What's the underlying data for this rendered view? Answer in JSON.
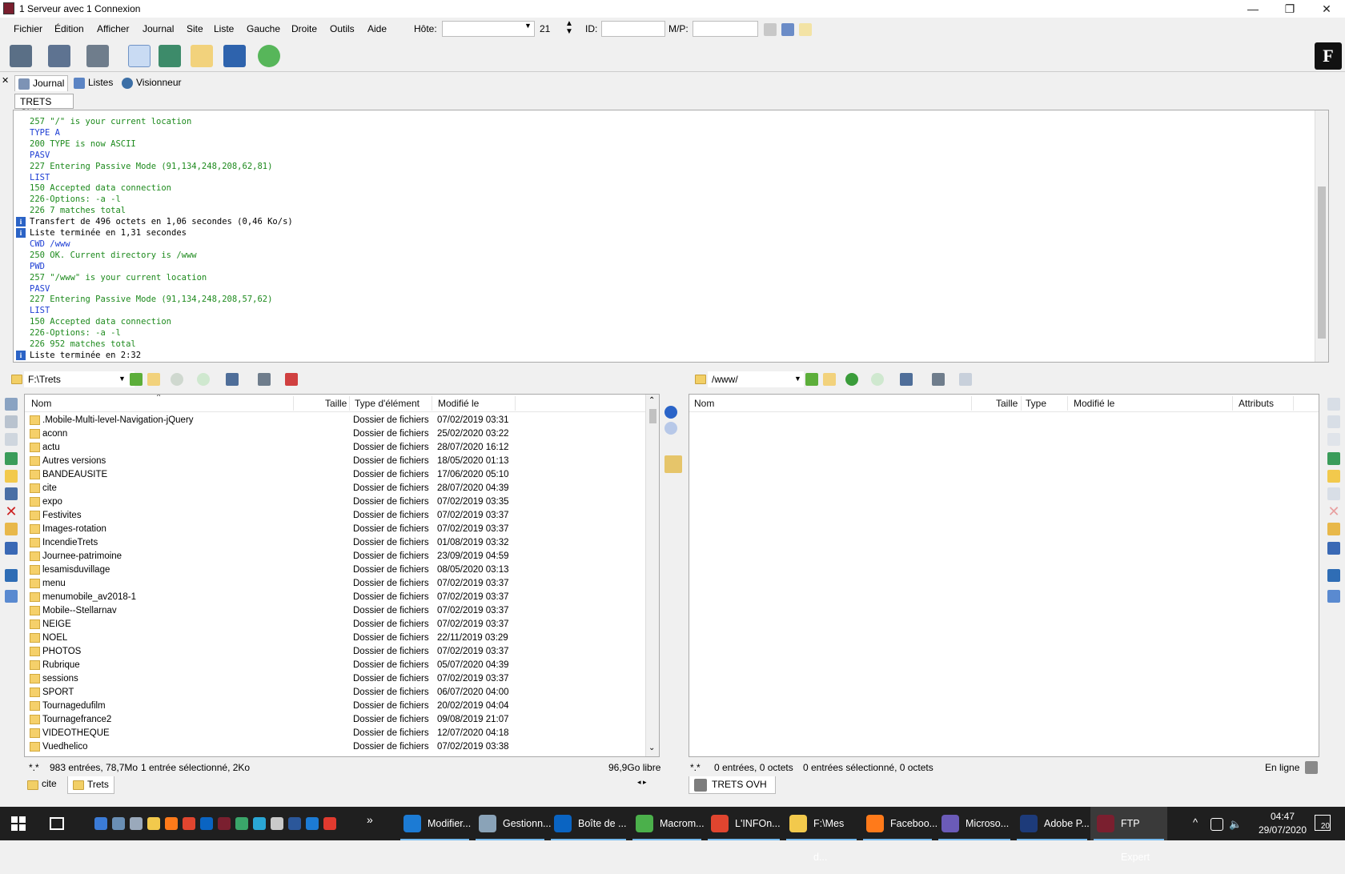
{
  "window": {
    "title": "1 Serveur avec 1 Connexion",
    "minimize": "—",
    "restore": "❐",
    "close": "✕"
  },
  "menu": [
    "Fichier",
    "Édition",
    "Afficher",
    "Journal",
    "Site",
    "Liste",
    "Gauche",
    "Droite",
    "Outils",
    "Aide"
  ],
  "connbar": {
    "host_label": "Hôte:",
    "host_value": "",
    "port_value": "21",
    "id_label": "ID:",
    "id_value": "",
    "pw_label": "M/P:",
    "pw_value": ""
  },
  "tabs": [
    {
      "label": "Journal",
      "icon": "journal-icon"
    },
    {
      "label": "Listes",
      "icon": "lists-icon"
    },
    {
      "label": "Visionneur",
      "icon": "viewer-icon"
    }
  ],
  "connection_tab": "TRETS OVH",
  "log": [
    {
      "text": "257 \"/\" is your current location",
      "kind": "resp"
    },
    {
      "text": "TYPE A",
      "kind": "cmd"
    },
    {
      "text": "200 TYPE is now ASCII",
      "kind": "resp"
    },
    {
      "text": "PASV",
      "kind": "cmd"
    },
    {
      "text": "227 Entering Passive Mode (91,134,248,208,62,81)",
      "kind": "resp"
    },
    {
      "text": "LIST",
      "kind": "cmd"
    },
    {
      "text": "150 Accepted data connection",
      "kind": "resp"
    },
    {
      "text": "226-Options: -a -l",
      "kind": "resp"
    },
    {
      "text": "226 7 matches total",
      "kind": "resp"
    },
    {
      "text": "Transfert de 496 octets en 1,06 secondes (0,46 Ko/s)",
      "kind": "info"
    },
    {
      "text": "Liste terminée en 1,31 secondes",
      "kind": "info"
    },
    {
      "text": "CWD /www",
      "kind": "cmd"
    },
    {
      "text": "250 OK. Current directory is /www",
      "kind": "resp"
    },
    {
      "text": "PWD",
      "kind": "cmd"
    },
    {
      "text": "257 \"/www\" is your current location",
      "kind": "resp"
    },
    {
      "text": "PASV",
      "kind": "cmd"
    },
    {
      "text": "227 Entering Passive Mode (91,134,248,208,57,62)",
      "kind": "resp"
    },
    {
      "text": "LIST",
      "kind": "cmd"
    },
    {
      "text": "150 Accepted data connection",
      "kind": "resp"
    },
    {
      "text": "226-Options: -a -l",
      "kind": "resp"
    },
    {
      "text": "226 952 matches total",
      "kind": "resp"
    },
    {
      "text": "Liste terminée en 2:32",
      "kind": "info"
    }
  ],
  "left": {
    "path": "F:\\Trets",
    "columns": [
      "Nom",
      "Taille",
      "Type d'élément",
      "Modifié le"
    ],
    "rows": [
      [
        ".Mobile-Multi-level-Navigation-jQuery",
        "Dossier de fichiers",
        "07/02/2019 03:31"
      ],
      [
        "aconn",
        "Dossier de fichiers",
        "25/02/2020 03:22"
      ],
      [
        "actu",
        "Dossier de fichiers",
        "28/07/2020 16:12"
      ],
      [
        "Autres versions",
        "Dossier de fichiers",
        "18/05/2020 01:13"
      ],
      [
        "BANDEAUSITE",
        "Dossier de fichiers",
        "17/06/2020 05:10"
      ],
      [
        "cite",
        "Dossier de fichiers",
        "28/07/2020 04:39"
      ],
      [
        "expo",
        "Dossier de fichiers",
        "07/02/2019 03:35"
      ],
      [
        "Festivites",
        "Dossier de fichiers",
        "07/02/2019 03:37"
      ],
      [
        "Images-rotation",
        "Dossier de fichiers",
        "07/02/2019 03:37"
      ],
      [
        "IncendieTrets",
        "Dossier de fichiers",
        "01/08/2019 03:32"
      ],
      [
        "Journee-patrimoine",
        "Dossier de fichiers",
        "23/09/2019 04:59"
      ],
      [
        "lesamisduvillage",
        "Dossier de fichiers",
        "08/05/2020 03:13"
      ],
      [
        "menu",
        "Dossier de fichiers",
        "07/02/2019 03:37"
      ],
      [
        "menumobile_av2018-1",
        "Dossier de fichiers",
        "07/02/2019 03:37"
      ],
      [
        "Mobile--Stellarnav",
        "Dossier de fichiers",
        "07/02/2019 03:37"
      ],
      [
        "NEIGE",
        "Dossier de fichiers",
        "07/02/2019 03:37"
      ],
      [
        "NOEL",
        "Dossier de fichiers",
        "22/11/2019 03:29"
      ],
      [
        "PHOTOS",
        "Dossier de fichiers",
        "07/02/2019 03:37"
      ],
      [
        "Rubrique",
        "Dossier de fichiers",
        "05/07/2020 04:39"
      ],
      [
        "sessions",
        "Dossier de fichiers",
        "07/02/2019 03:37"
      ],
      [
        "SPORT",
        "Dossier de fichiers",
        "06/07/2020 04:00"
      ],
      [
        "Tournagedufilm",
        "Dossier de fichiers",
        "20/02/2019 04:04"
      ],
      [
        "Tournagefrance2",
        "Dossier de fichiers",
        "09/08/2019 21:07"
      ],
      [
        "VIDEOTHEQUE",
        "Dossier de fichiers",
        "12/07/2020 04:18"
      ],
      [
        "Vuedhelico",
        "Dossier de fichiers",
        "07/02/2019 03:38"
      ]
    ],
    "status": {
      "filter": "*.*",
      "entries": "983 entrées, 78,7Mo",
      "selected": "1 entrée sélectionné, 2Ko",
      "free": "96,9Go libre"
    },
    "bottom_tabs": [
      "cite",
      "Trets"
    ]
  },
  "right": {
    "path": "/www/",
    "columns": [
      "Nom",
      "Taille",
      "Type",
      "Modifié le",
      "Attributs"
    ],
    "status": {
      "filter": "*.*",
      "entries": "0 entrées, 0 octets",
      "selected": "0 entrées sélectionné, 0 octets",
      "state": "En ligne"
    },
    "bottom_tab": "TRETS OVH"
  },
  "taskbar": {
    "items": [
      {
        "label": "Modifier...",
        "color": "#1c7bd4"
      },
      {
        "label": "Gestionn...",
        "color": "#8aa3b8"
      },
      {
        "label": "Boîte de ...",
        "color": "#0a64c2"
      },
      {
        "label": "Macrom...",
        "color": "#4bb04b"
      },
      {
        "label": "L'INFOn...",
        "color": "#e0452f"
      },
      {
        "label": "F:\\Mes d...",
        "color": "#f2c94c"
      },
      {
        "label": "Faceboo...",
        "color": "#ff7a1a"
      },
      {
        "label": "Microso...",
        "color": "#6b5bb8"
      },
      {
        "label": "Adobe P...",
        "color": "#1d3b7a"
      },
      {
        "label": "FTP Expert",
        "color": "#7a1f2f"
      }
    ],
    "time": "04:47",
    "date": "29/07/2020",
    "notif_count": "20",
    "overflow": "»"
  }
}
